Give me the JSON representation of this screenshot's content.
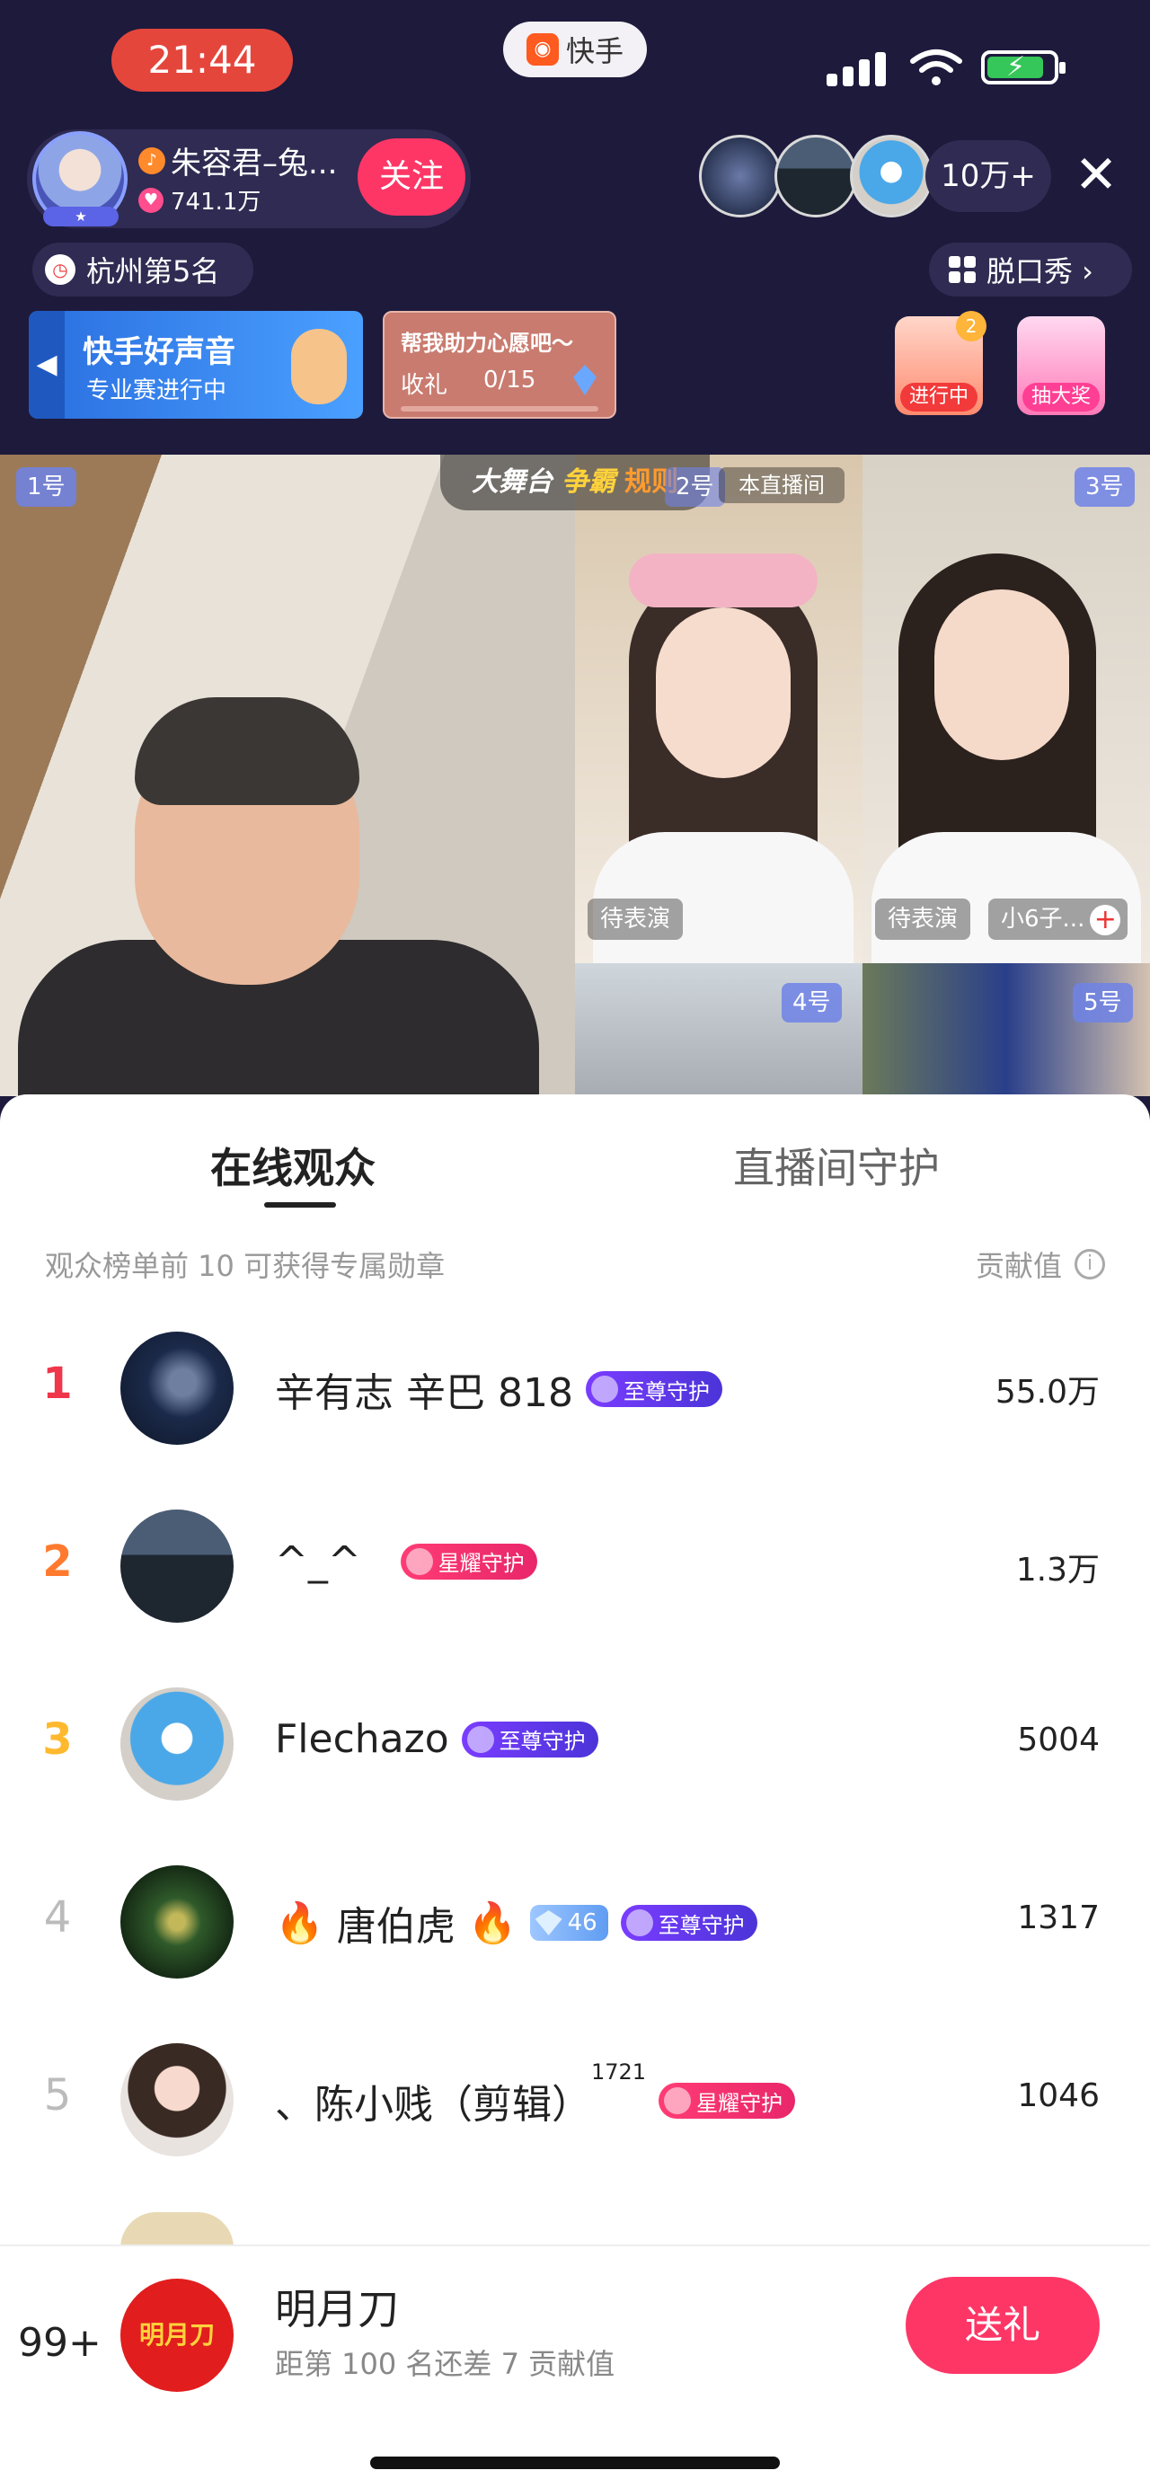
{
  "status_bar": {
    "time": "21:44",
    "app_pill": "快手"
  },
  "header": {
    "host_name": "朱容君–兔...",
    "host_likes": "741.1万",
    "follow_label": "关注",
    "viewer_count": "10万+",
    "close_icon": "✕",
    "rank_label": "杭州第5名",
    "category_label": "脱口秀 ›"
  },
  "promo": {
    "banner_title": "快手好声音",
    "banner_subtitle": "专业赛进行中",
    "wish_title": "帮我助力心愿吧～",
    "wish_gift_label": "收礼",
    "wish_progress": "0/15",
    "activity_badge": "2",
    "activity_label": "进行中",
    "lottery_label": "抽大奖"
  },
  "video": {
    "seat1": "1号",
    "seat2": "2号",
    "seat3": "3号",
    "seat4": "4号",
    "seat5": "5号",
    "stage_prefix": "大舞台",
    "stage_highlight": "争霸",
    "stage_rule": "规则",
    "this_room": "本直播间",
    "seat2_status": "待表演",
    "seat3_status": "待表演",
    "seat3_user": "小6子..."
  },
  "sheet": {
    "tab_active": "在线观众",
    "tab_inactive": "直播间守护",
    "hint": "观众榜单前 10 可获得专属勋章",
    "score_header": "贡献值",
    "rows": [
      {
        "rank": "1",
        "name": "辛有志 辛巴 818",
        "badge": "至尊守护",
        "score": "55.0万"
      },
      {
        "rank": "2",
        "name": "^_^",
        "badge": "星耀守护",
        "score": "1.3万"
      },
      {
        "rank": "3",
        "name": "Flechazo",
        "badge": "至尊守护",
        "score": "5004"
      },
      {
        "rank": "4",
        "name": "唐伯虎",
        "level": "46",
        "badge": "至尊守护",
        "score": "1317"
      },
      {
        "rank": "5",
        "name": "、陈小贱（剪辑）",
        "sup": "1721",
        "badge": "星耀守护",
        "score": "1046"
      }
    ]
  },
  "me": {
    "rank": "99+",
    "avatar_text": "明月刀",
    "name": "明月刀",
    "gap_text": "距第 100 名还差 7 贡献值",
    "gift_label": "送礼"
  },
  "colors": {
    "accent": "#fe3666",
    "header_bg": "#1d1a3c",
    "rank1": "#f0364a",
    "rank2": "#ff7a2e",
    "rank3": "#ffb92e"
  }
}
